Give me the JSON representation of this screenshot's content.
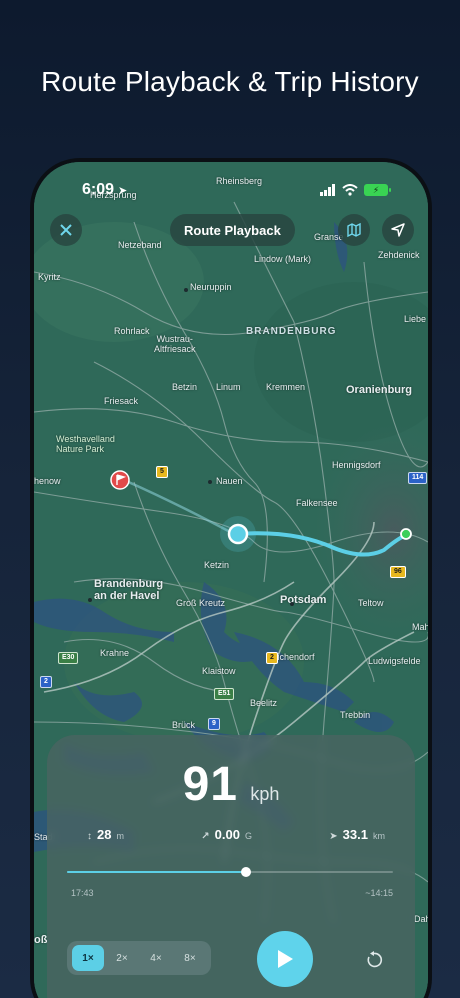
{
  "headline": "Route Playback & Trip History",
  "status": {
    "time": "6:09"
  },
  "header": {
    "title": "Route Playback"
  },
  "map": {
    "region": "BRANDENBURG",
    "places": [
      {
        "id": "rheinsberg",
        "name": "Rheinsberg"
      },
      {
        "id": "herzsprung",
        "name": "Herzsprung"
      },
      {
        "id": "netzeband",
        "name": "Netzeband"
      },
      {
        "id": "gransee",
        "name": "Granse"
      },
      {
        "id": "zehdenick",
        "name": "Zehdenick"
      },
      {
        "id": "kyritz",
        "name": "Kyritz"
      },
      {
        "id": "lindow",
        "name": "Lindow (Mark)"
      },
      {
        "id": "neuruppin",
        "name": "Neuruppin"
      },
      {
        "id": "rohrlack",
        "name": "Rohrlack"
      },
      {
        "id": "wustrau",
        "name": "Wustrau-\nAltfriesack"
      },
      {
        "id": "liebe",
        "name": "Liebe"
      },
      {
        "id": "betzin",
        "name": "Betzin"
      },
      {
        "id": "linum",
        "name": "Linum"
      },
      {
        "id": "kremmen",
        "name": "Kremmen"
      },
      {
        "id": "oranienburg",
        "name": "Oranienburg"
      },
      {
        "id": "friesack",
        "name": "Friesack"
      },
      {
        "id": "westhavelland",
        "name": "Westhavelland\nNature Park"
      },
      {
        "id": "rathenow",
        "name": "henow"
      },
      {
        "id": "hennigsdorf",
        "name": "Hennigsdorf"
      },
      {
        "id": "nauen",
        "name": "Nauen"
      },
      {
        "id": "falkensee",
        "name": "Falkensee"
      },
      {
        "id": "ketzin",
        "name": "Ketzin"
      },
      {
        "id": "brandenburg",
        "name": "Brandenburg\nan der Havel"
      },
      {
        "id": "grosskreutz",
        "name": "Groß Kreutz"
      },
      {
        "id": "potsdam",
        "name": "Potsdam"
      },
      {
        "id": "teltow",
        "name": "Teltow"
      },
      {
        "id": "mahl",
        "name": "Mah"
      },
      {
        "id": "krahne",
        "name": "Krahne"
      },
      {
        "id": "michendorf",
        "name": "Michendorf"
      },
      {
        "id": "ludwigsfelde",
        "name": "Ludwigsfelde"
      },
      {
        "id": "klaistow",
        "name": "Klaistow"
      },
      {
        "id": "beelitz",
        "name": "Beelitz"
      },
      {
        "id": "bruck",
        "name": "Brück"
      },
      {
        "id": "trebbin",
        "name": "Trebbin"
      },
      {
        "id": "stad",
        "name": "Stad"
      },
      {
        "id": "gross",
        "name": "oß"
      },
      {
        "id": "dah",
        "name": "Dah"
      }
    ],
    "shields": [
      {
        "id": "b5",
        "text": "5",
        "style": "yellow"
      },
      {
        "id": "a114",
        "text": "114",
        "style": "blue"
      },
      {
        "id": "b96",
        "text": "96",
        "style": "yellow"
      },
      {
        "id": "e30",
        "text": "E30",
        "style": "green"
      },
      {
        "id": "a2",
        "text": "2",
        "style": "blue"
      },
      {
        "id": "b2",
        "text": "2",
        "style": "yellow"
      },
      {
        "id": "e51",
        "text": "E51",
        "style": "green"
      },
      {
        "id": "a9",
        "text": "9",
        "style": "blue"
      }
    ]
  },
  "panel": {
    "speed": "91",
    "speed_unit": "kph",
    "stats": [
      {
        "icon": "altitude-icon",
        "glyph": "↕",
        "value": "28",
        "unit": "m"
      },
      {
        "icon": "gforce-icon",
        "glyph": "↗",
        "value": "0.00",
        "unit": "G"
      },
      {
        "icon": "distance-icon",
        "glyph": "➤",
        "value": "33.1",
        "unit": "km"
      }
    ],
    "progress": 0.55,
    "start_time": "17:43",
    "end_time": "~14:15",
    "speeds": [
      "1×",
      "2×",
      "4×",
      "8×"
    ],
    "active_speed": "1×"
  },
  "colors": {
    "accent": "#5fd3eb",
    "route": "#5ccfe6"
  }
}
